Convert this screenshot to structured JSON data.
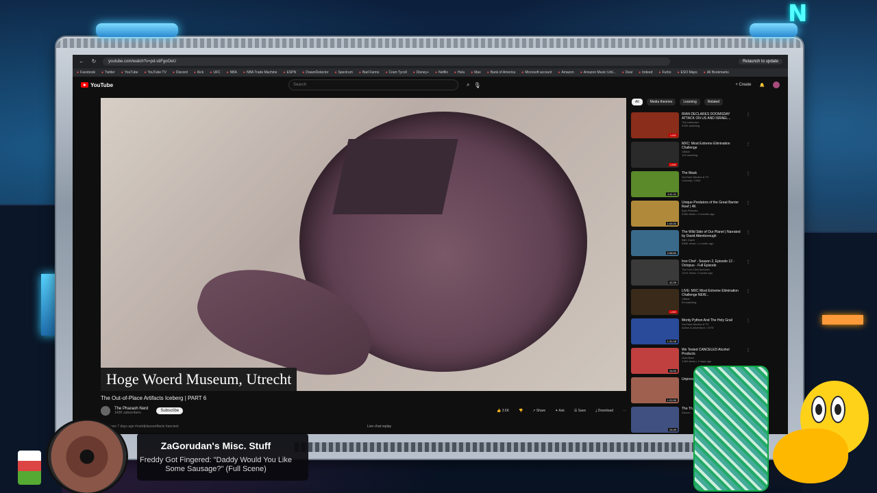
{
  "browser": {
    "url": "youtube.com/watch?v=pd-stiFgoOeU",
    "relaunch_label": "Relaunch to update",
    "bookmarks": [
      "Facebook",
      "Twitter",
      "YouTube",
      "YouTube TV",
      "Discord",
      "Kick",
      "UFC",
      "NBA",
      "NBA Trade Machine",
      "ESPN",
      "DrawnDetector",
      "Spectrum",
      "Bad Farms",
      "Cram Tycoll",
      "Disney+",
      "Netflix",
      "Hulu",
      "Max",
      "Bank of America",
      "Microsoft account",
      "Amazon",
      "Amazon Music Unli...",
      "Deal",
      "Indeed",
      "Furbo",
      "ESO Maps",
      "All Bookmarks"
    ]
  },
  "youtube": {
    "logo_text": "YouTube",
    "search_placeholder": "Search",
    "create_label": "+ Create",
    "video": {
      "caption": "Hoge Woerd Museum, Utrecht",
      "title": "The Out-of-Place Artifacts Iceberg | PART 6",
      "channel": "The Pharaoh Nerd",
      "subscribers": "143K subscribers",
      "subscribe_label": "Subscribe",
      "likes": "3.5K",
      "share_label": "Share",
      "ask_label": "Ask",
      "save_label": "Save",
      "download_label": "Download",
      "description": "52K views  7 days ago  #outofplaceartifacts #ancient",
      "chat_replay": "Live chat replay"
    },
    "chips": [
      "All",
      "Media theories",
      "Learning",
      "Related"
    ],
    "sidebar": [
      {
        "title": "IRAN DECLARES DOOMSDAY ATTACK ON US AND ISRAEL...",
        "channel": "The Unknown",
        "stats": "315K watching",
        "badge": "LIVE",
        "thumb": "#8a2d1a"
      },
      {
        "title": "MXC: Most Extreme Elimination Challenge",
        "channel": "CBNet",
        "stats": "113 watching",
        "badge": "LIVE",
        "thumb": "#2a2a2a"
      },
      {
        "title": "The Mask",
        "channel": "YouTube Movies & TV",
        "stats": "Comedy • 1994",
        "badge": "1:41:11",
        "thumb": "#5a8a2a"
      },
      {
        "title": "Unique Predators of the Great Barrier Reef | 4K",
        "channel": "Epic Pictures",
        "stats": "3.6M views • 4 months ago",
        "badge": "1:04:00",
        "thumb": "#b08a3a"
      },
      {
        "title": "The Wild Side of Our Planet | Narrated by David Attenborough",
        "channel": "BBC Earth",
        "stats": "935K views • 1 month ago",
        "badge": "2:58:50",
        "thumb": "#3a6a8a"
      },
      {
        "title": "Iron Chef - Season 2, Episode 12 - Octopus - Full Episode",
        "channel": "The Iron Chef Archives",
        "stats": "121K views • 3 years ago",
        "badge": "41:29",
        "thumb": "#3a3a3a"
      },
      {
        "title": "LIVE: MXC Most Extreme Elimination Challenge NEW...",
        "channel": "CBNet",
        "stats": "93 watching",
        "badge": "LIVE",
        "thumb": "#3a2a1a"
      },
      {
        "title": "Monty Python And The Holy Grail",
        "channel": "YouTube Movies & TV",
        "stats": "Action & adventure • 1975",
        "badge": "1:31:28",
        "thumb": "#2a4a9a"
      },
      {
        "title": "We Tested CANCELED Alcohol Products",
        "channel": "Gold Bars",
        "stats": "1.6M views • 2 days ago",
        "badge": "24:00",
        "thumb": "#c04040"
      },
      {
        "title": "Unprecedented...",
        "channel": "",
        "stats": "",
        "badge": "1:22:55",
        "thumb": "#a06050"
      },
      {
        "title": "The Th...",
        "channel": "Discov...",
        "stats": "",
        "badge": "24:49",
        "thumb": "#405080"
      }
    ]
  },
  "overlay": {
    "channel": "ZaGorudan's Misc. Stuff",
    "now_playing": "Freddy Got Fingered: \"Daddy Would You Like Some Sausage?\" (Full Scene)"
  },
  "neon_letter": "N"
}
